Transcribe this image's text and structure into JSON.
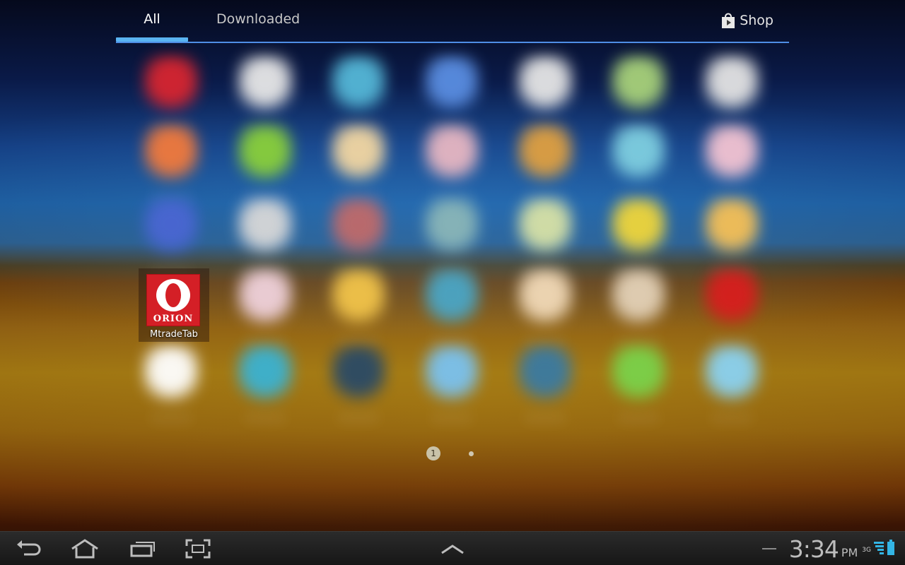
{
  "tabs": [
    {
      "label": "All",
      "selected": true
    },
    {
      "label": "Downloaded",
      "selected": false
    }
  ],
  "shop": {
    "label": "Shop",
    "icon": "shop-bag-icon"
  },
  "focused_app": {
    "name": "MtradeTab",
    "icon": "orion-logo-icon",
    "icon_letter": "O",
    "icon_text": "ORION",
    "brand_color": "#d41f26"
  },
  "blurred_apps": [
    "#d82530",
    "#e8e8e8",
    "#55b8d8",
    "#5a8ee2",
    "#e6e6e6",
    "#a8d27a",
    "#e4e4e4",
    "#f27a3c",
    "#8ad03a",
    "#f3d7a2",
    "#e8b7c2",
    "#e0a040",
    "#7fcfe0",
    "#f4c4d2",
    "#4a66d2",
    "#d8d8d8",
    "#c06a6a",
    "#8ab6b8",
    "#d8e2a6",
    "#f0d63a",
    "#f6c056",
    "#f0d2dc",
    "#f2c44a",
    "#4aa6c6",
    "#f2dab8",
    "#e4d2b8",
    "#d81e1e",
    "#ffffff",
    "#3ab2d2",
    "#2a4a66",
    "#7ac2f0",
    "#3a7aa2",
    "#7ad24a",
    "#8ad2f2"
  ],
  "pager": {
    "current_page": "1",
    "total_pages": 2
  },
  "nav": {
    "back": "back-icon",
    "home": "home-icon",
    "recent": "recent-apps-icon",
    "screenshot": "screenshot-icon",
    "drawer": "chevron-up-icon"
  },
  "status": {
    "time": "3:34",
    "ampm": "PM",
    "network": "3G",
    "signal_icon": "signal-icon",
    "battery_icon": "battery-icon"
  }
}
